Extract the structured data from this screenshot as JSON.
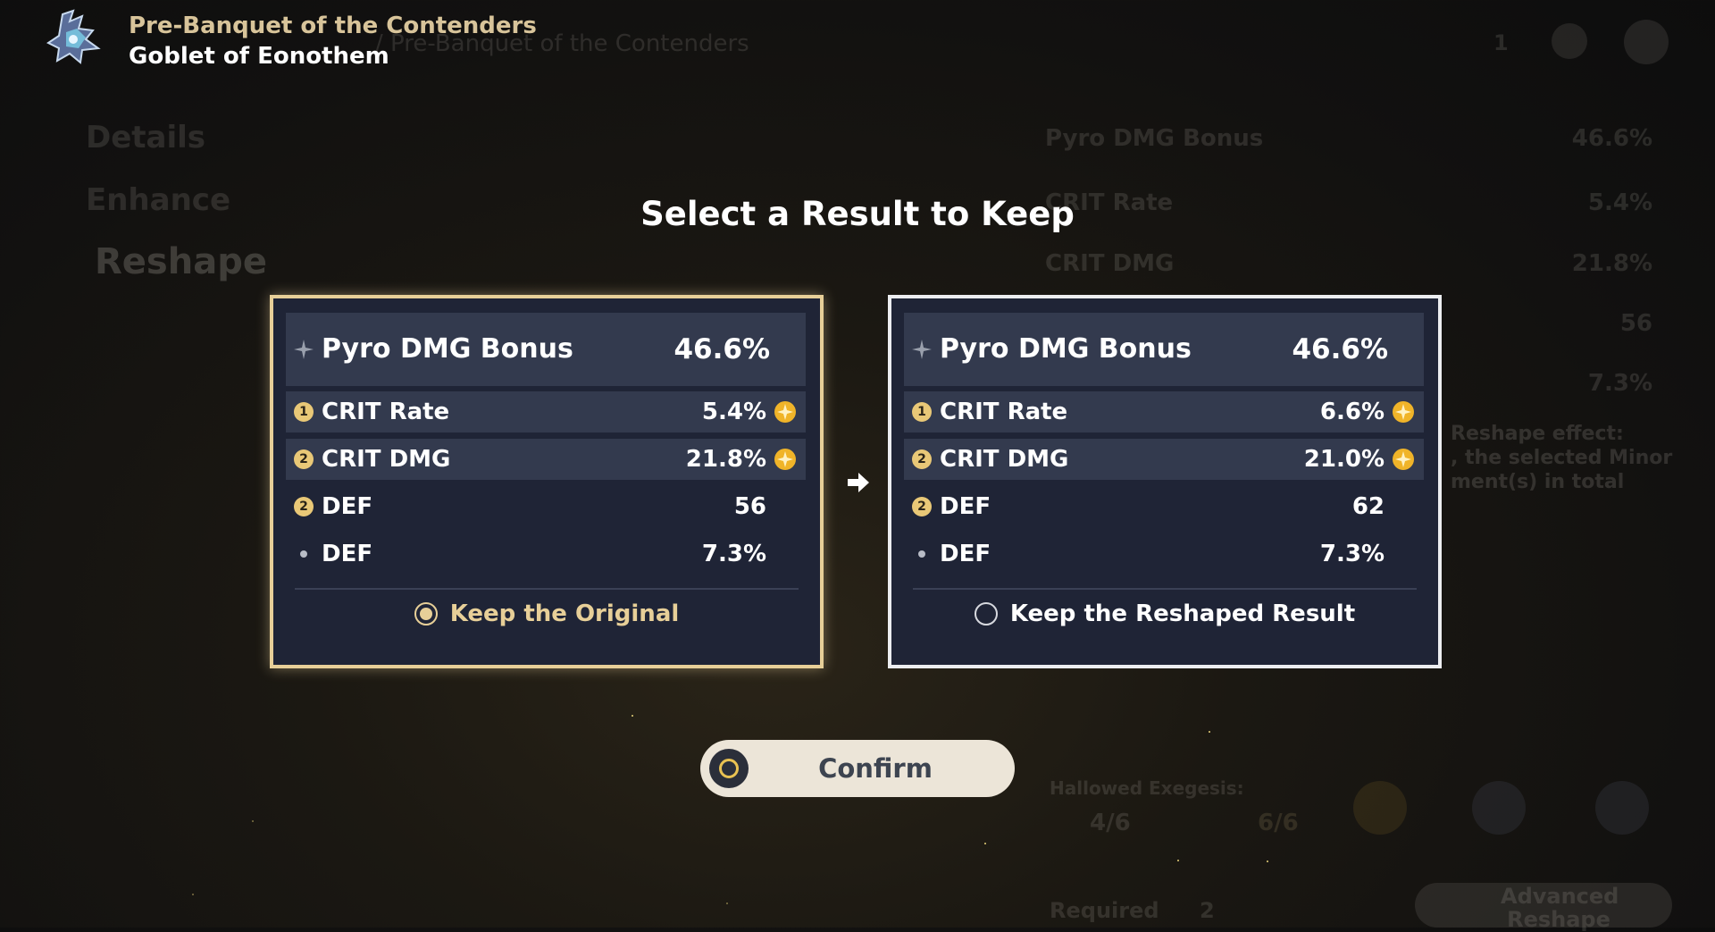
{
  "header": {
    "title": "Pre-Banquet of the Contenders",
    "subtitle": "Goblet of Eonothem",
    "icon": "goblet-icon"
  },
  "background": {
    "breadcrumb": "/ Pre-Banquet of the Contenders",
    "nav": [
      "Details",
      "Enhance",
      "Reshape"
    ],
    "material_count": "1",
    "stats": [
      {
        "name": "Pyro DMG Bonus",
        "value": "46.6%"
      },
      {
        "name": "CRIT Rate",
        "value": "5.4%"
      },
      {
        "name": "CRIT DMG",
        "value": "21.8%"
      },
      {
        "name": "",
        "value": "56"
      },
      {
        "name": "",
        "value": "7.3%"
      }
    ],
    "effect_text": [
      "Reshape effect:",
      ", the selected Minor",
      "ment(s) in total"
    ],
    "hallowed_label": "Hallowed Exegesis:",
    "hallowed_a": "4/6",
    "hallowed_b": "6/6",
    "required_label": "Required",
    "required_value": "2",
    "advanced_label": "Advanced Reshape"
  },
  "main_title": "Select a Result to Keep",
  "original": {
    "main_stat": {
      "name": "Pyro DMG Bonus",
      "value": "46.6%"
    },
    "substats": [
      {
        "marker": "1",
        "name": "CRIT Rate",
        "value": "5.4%",
        "boosted": true
      },
      {
        "marker": "2",
        "name": "CRIT DMG",
        "value": "21.8%",
        "boosted": true
      },
      {
        "marker": "2",
        "name": "DEF",
        "value": "56",
        "boosted": false
      },
      {
        "marker": "dot",
        "name": "DEF",
        "value": "7.3%",
        "boosted": false
      }
    ],
    "option_label": "Keep the Original",
    "selected": true
  },
  "reshaped": {
    "main_stat": {
      "name": "Pyro DMG Bonus",
      "value": "46.6%"
    },
    "substats": [
      {
        "marker": "1",
        "name": "CRIT Rate",
        "value": "6.6%",
        "boosted": true
      },
      {
        "marker": "2",
        "name": "CRIT DMG",
        "value": "21.0%",
        "boosted": true
      },
      {
        "marker": "2",
        "name": "DEF",
        "value": "62",
        "boosted": false
      },
      {
        "marker": "dot",
        "name": "DEF",
        "value": "7.3%",
        "boosted": false
      }
    ],
    "option_label": "Keep the Reshaped Result",
    "selected": false
  },
  "confirm_label": "Confirm",
  "colors": {
    "gold": "#e7cf98",
    "card_bg": "#1f2436",
    "row_highlight": "#333a4e",
    "boost": "#f0b429"
  }
}
